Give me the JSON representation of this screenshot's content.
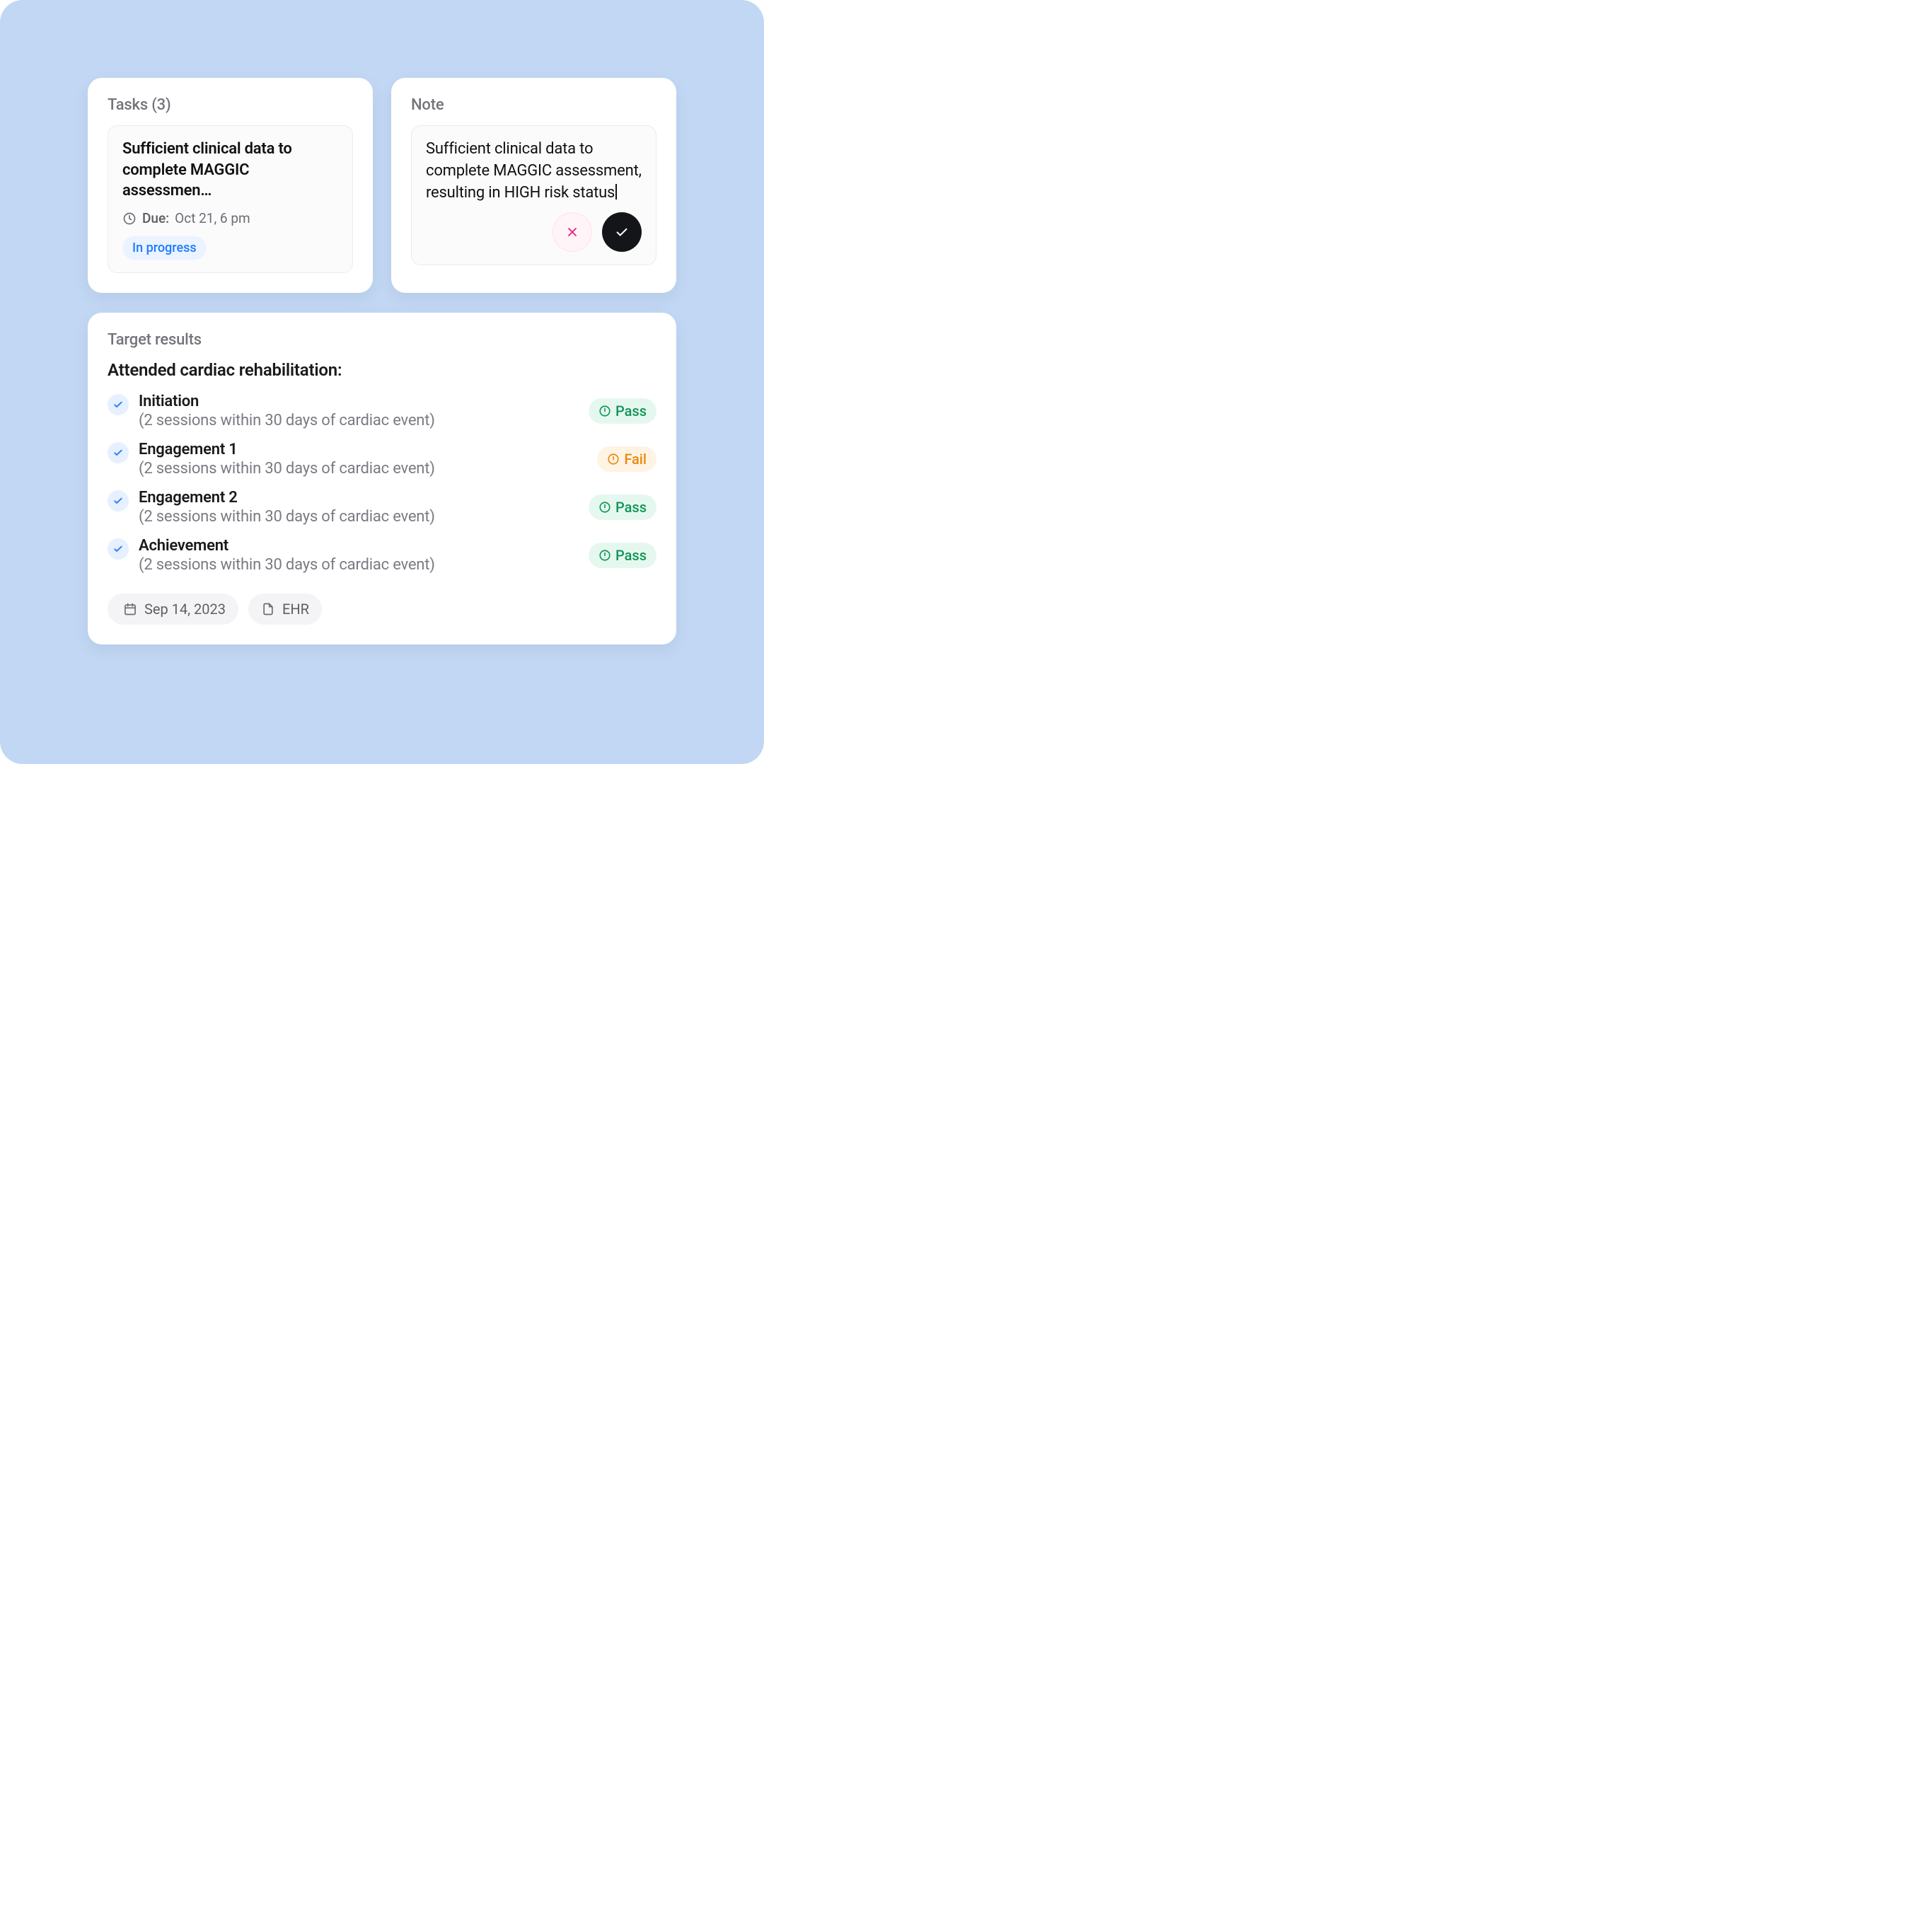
{
  "tasks": {
    "title": "Tasks (3)",
    "item": {
      "title": "Sufficient clinical data to complete MAGGIC assessmen…",
      "due_label": "Due:",
      "due_value": "Oct 21, 6 pm",
      "status": "In progress"
    }
  },
  "note": {
    "title": "Note",
    "text": "Sufficient clinical data to complete MAGGIC assessment, resulting in HIGH risk status"
  },
  "target": {
    "title": "Target results",
    "heading": "Attended cardiac rehabilitation:",
    "date": "Sep 14, 2023",
    "source": "EHR",
    "results": [
      {
        "name": "Initiation",
        "desc": "(2 sessions within 30 days of cardiac event)",
        "status": "Pass"
      },
      {
        "name": "Engagement 1",
        "desc": "(2 sessions within 30 days of cardiac event)",
        "status": "Fail"
      },
      {
        "name": "Engagement 2",
        "desc": "(2 sessions within 30 days of cardiac event)",
        "status": "Pass"
      },
      {
        "name": "Achievement",
        "desc": "(2 sessions within 30 days of cardiac event)",
        "status": "Pass"
      }
    ]
  }
}
